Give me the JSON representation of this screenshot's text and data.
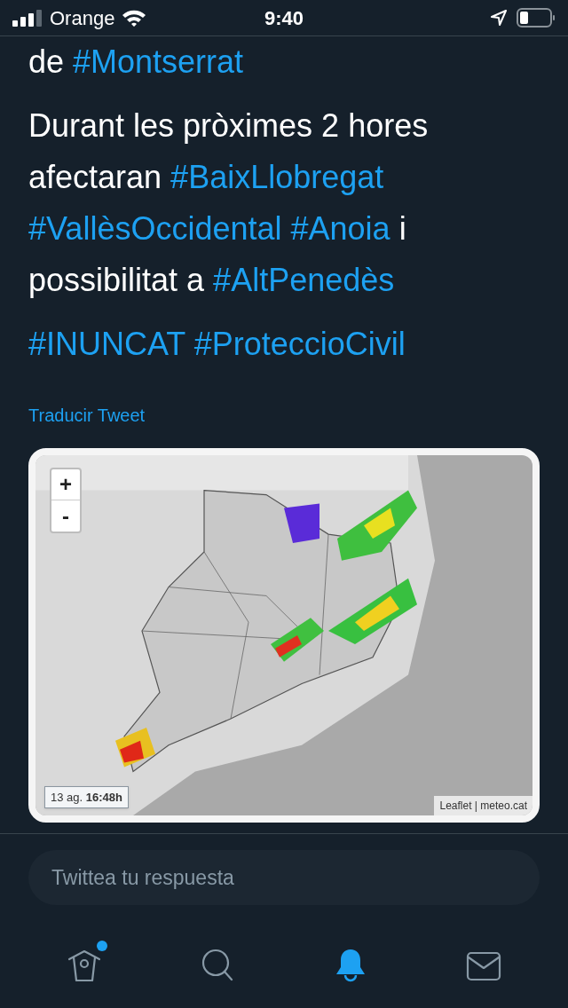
{
  "status_bar": {
    "carrier": "Orange",
    "time": "9:40"
  },
  "tweet": {
    "paragraphs": [
      [
        {
          "kind": "text",
          "text": "de "
        },
        {
          "kind": "hashtag",
          "text": "#Montserrat"
        }
      ],
      [
        {
          "kind": "text",
          "text": "Durant les pròximes 2 hores afectaran "
        },
        {
          "kind": "hashtag",
          "text": "#BaixLlobregat"
        },
        {
          "kind": "hashtag",
          "text": "#VallèsOccidental"
        },
        {
          "kind": "hashtag",
          "text": "#Anoia"
        },
        {
          "kind": "text",
          "text": " i possibilitat a "
        },
        {
          "kind": "hashtag",
          "text": "#AltPenedès"
        }
      ],
      [
        {
          "kind": "hashtag",
          "text": "#INUNCAT"
        },
        {
          "kind": "hashtag",
          "text": "#ProteccioCivil"
        }
      ]
    ],
    "translate_link": "Traducir Tweet",
    "map": {
      "zoom_in": "+",
      "zoom_out": "-",
      "timestamp_date": "13 ag.",
      "timestamp_time": "16:48h",
      "attribution": "Leaflet | meteo.cat"
    }
  },
  "reply_field": {
    "placeholder": "Twittea tu respuesta"
  },
  "nav": [
    {
      "kind": "home",
      "selected": false,
      "badge": true
    },
    {
      "kind": "search",
      "selected": false
    },
    {
      "kind": "notifications",
      "selected": true
    },
    {
      "kind": "messages",
      "selected": false
    }
  ]
}
